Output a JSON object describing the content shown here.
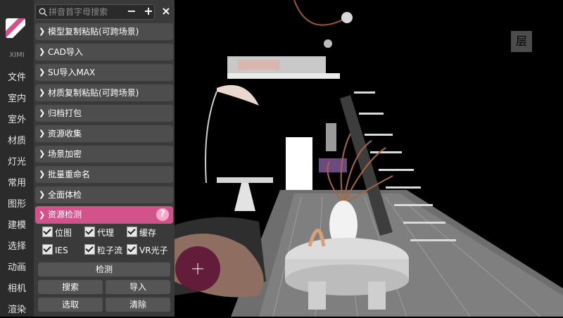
{
  "brand": {
    "name": "XIMI"
  },
  "categories": [
    "文件",
    "室内",
    "室外",
    "材质",
    "灯光",
    "常用",
    "图形",
    "建模",
    "选择",
    "动画",
    "相机",
    "渲染"
  ],
  "search": {
    "placeholder": "拼音首字母搜索",
    "value": ""
  },
  "controls": {
    "minimize": "−",
    "add": "+",
    "close": "×"
  },
  "menu": [
    {
      "label": "模型复制粘贴(可跨场景)"
    },
    {
      "label": "CAD导入"
    },
    {
      "label": "SU导入MAX"
    },
    {
      "label": "材质复制粘贴(可跨场景)"
    },
    {
      "label": "归档打包"
    },
    {
      "label": "资源收集"
    },
    {
      "label": "场景加密"
    },
    {
      "label": "批量重命名"
    },
    {
      "label": "全面体检"
    }
  ],
  "section": {
    "title": "资源检测",
    "help": "?",
    "checkboxes": [
      {
        "label": "位图",
        "checked": true
      },
      {
        "label": "代理",
        "checked": true
      },
      {
        "label": "缓存",
        "checked": true
      },
      {
        "label": "IES",
        "checked": true
      },
      {
        "label": "粒子流",
        "checked": true
      },
      {
        "label": "VR光子",
        "checked": true
      }
    ],
    "buttons": {
      "detect": "检测",
      "search": "搜索",
      "import": "导入",
      "select": "选取",
      "clear": "清除"
    }
  },
  "viewport": {
    "cube_label": "层"
  },
  "colors": {
    "accent": "#d3528c",
    "panel": "#3a3a3a",
    "item": "#4d4d4d",
    "sidebar": "#2b2b2b"
  }
}
